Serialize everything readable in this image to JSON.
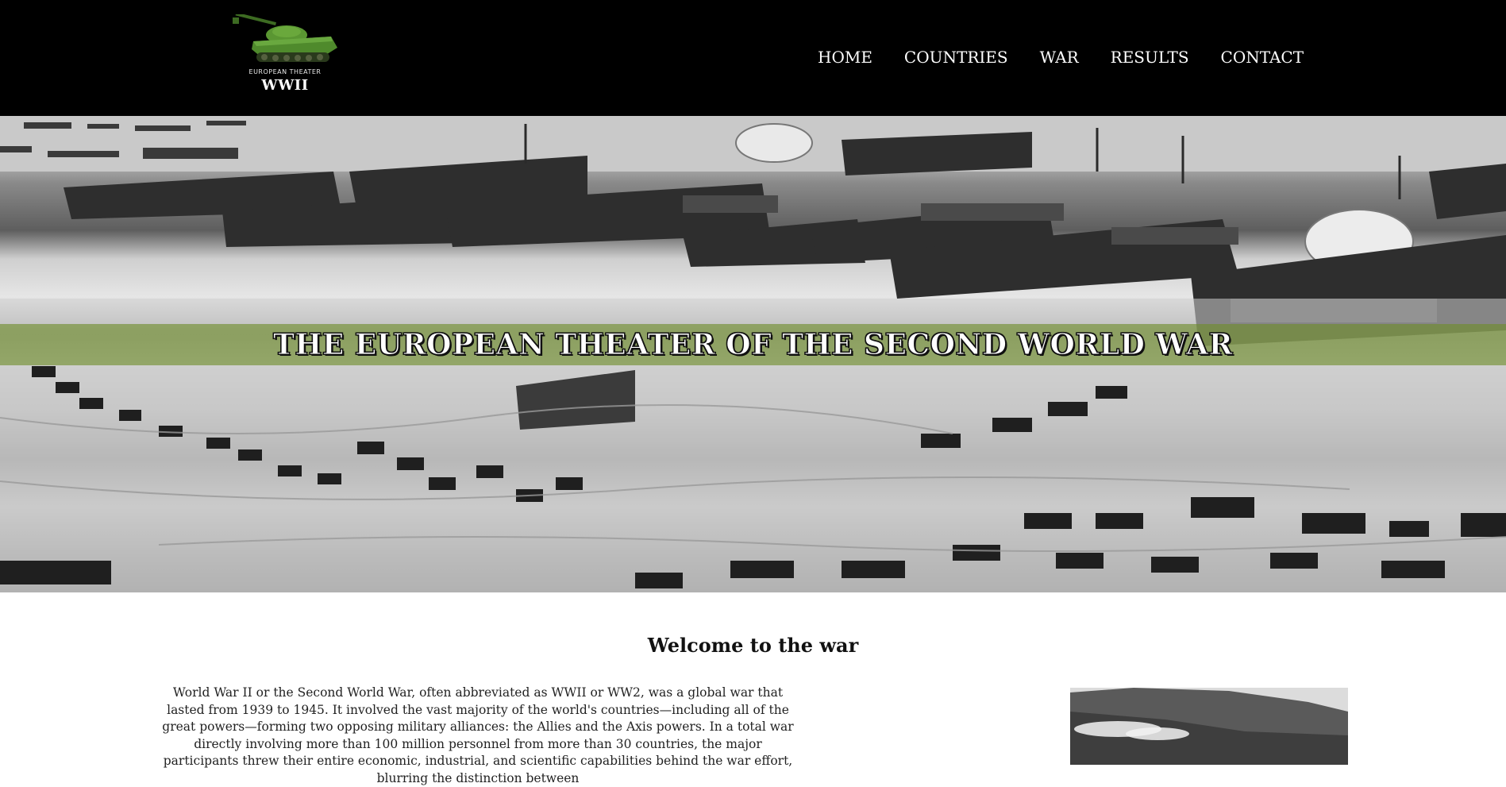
{
  "header": {
    "logo": {
      "subtitle": "EUROPEAN THEATER",
      "title": "WWII",
      "icon": "tank-icon"
    },
    "nav": [
      {
        "label": "HOME"
      },
      {
        "label": "COUNTRIES"
      },
      {
        "label": "WAR"
      },
      {
        "label": "RESULTS"
      },
      {
        "label": "CONTACT"
      }
    ]
  },
  "hero": {
    "title": "THE EUROPEAN THEATER OF THE SECOND WORLD WAR",
    "band_color": "#6e8c28"
  },
  "main": {
    "heading": "Welcome to the war",
    "intro": "World War II or the Second World War, often abbreviated as WWII or WW2, was a global war that lasted from 1939 to 1945. It involved the vast majority of the world's countries—including all of the great powers—forming two opposing military alliances: the Allies and the Axis powers. In a total war directly involving more than 100 million personnel from more than 30 countries, the major participants threw their entire economic, industrial, and scientific capabilities behind the war effort, blurring the distinction between"
  },
  "colors": {
    "header_bg": "#000000",
    "nav_text": "#ffffff",
    "tank_green": "#4f8a2c"
  }
}
